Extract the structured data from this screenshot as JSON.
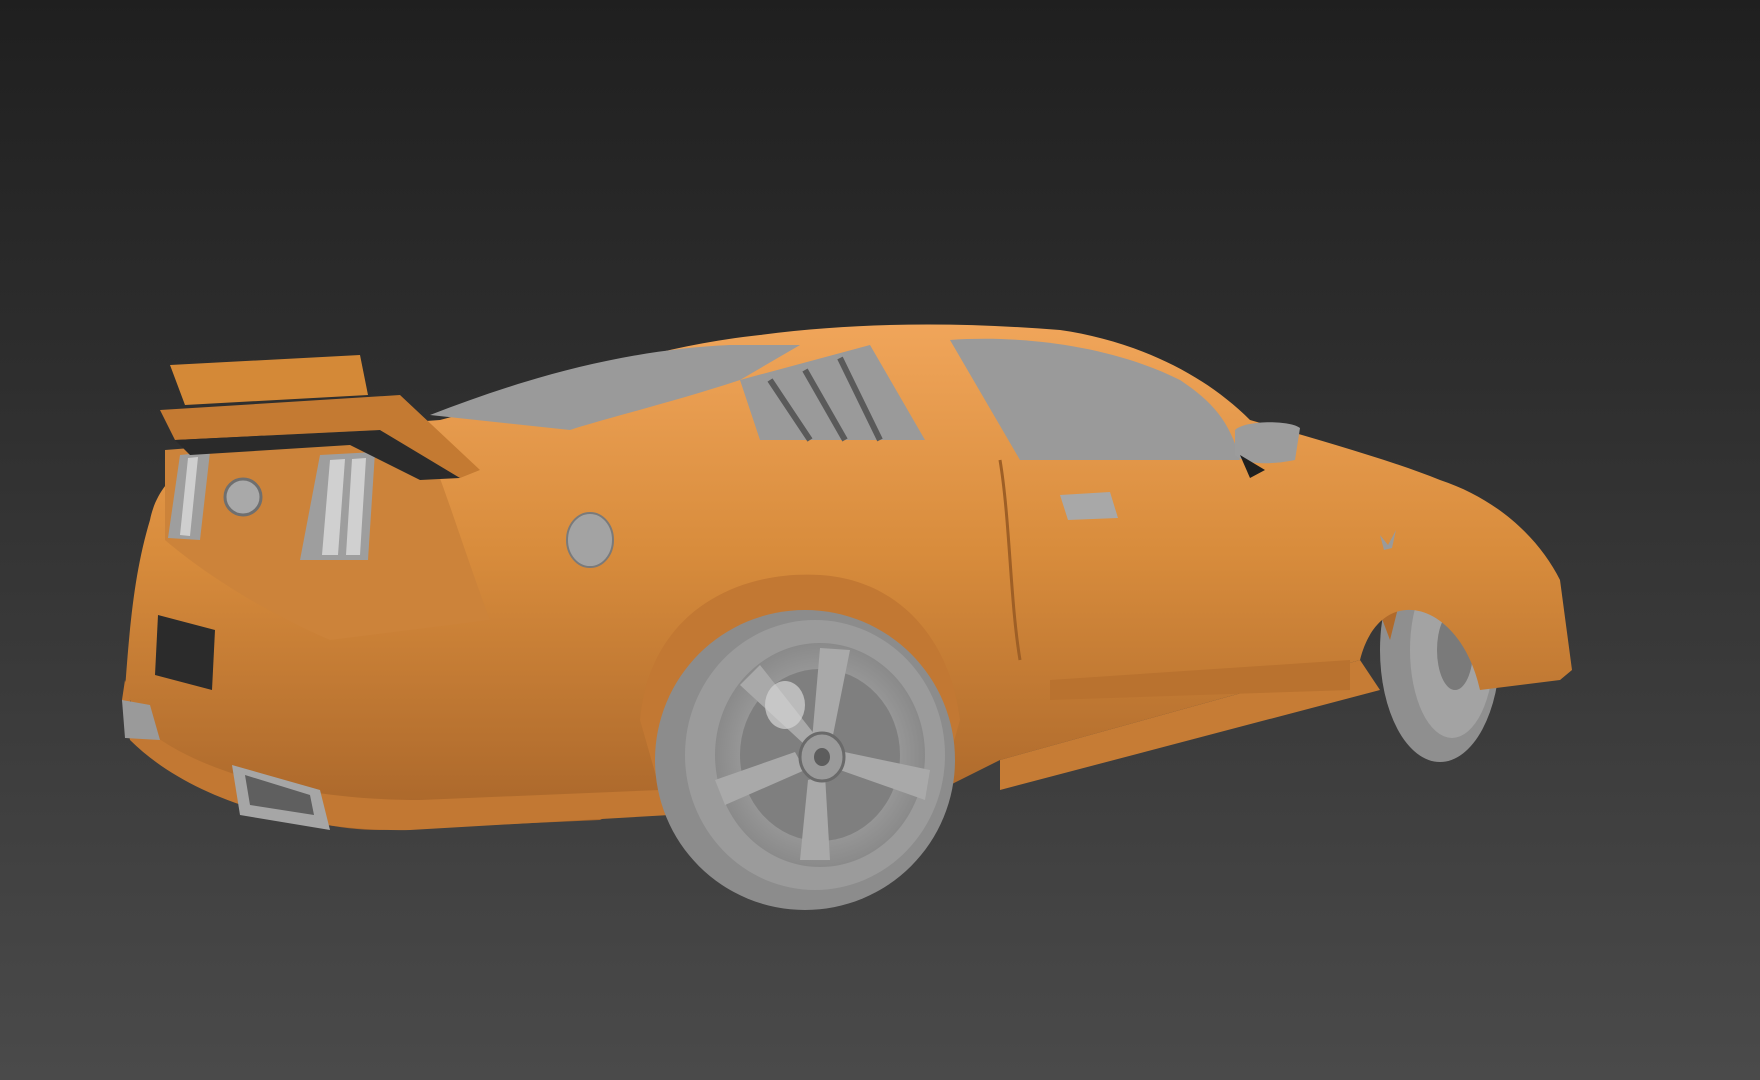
{
  "viewport": {
    "background_top": "#1f1f1f",
    "background_bottom": "#4a4a4a"
  },
  "model": {
    "body_color": "#d88c3c",
    "body_shadow_color": "#a8652a",
    "body_highlight_color": "#f0a55a",
    "trim_color": "#a9a9a9",
    "trim_dark_color": "#6b6b6b",
    "glass_color": "#9c9c9c"
  }
}
